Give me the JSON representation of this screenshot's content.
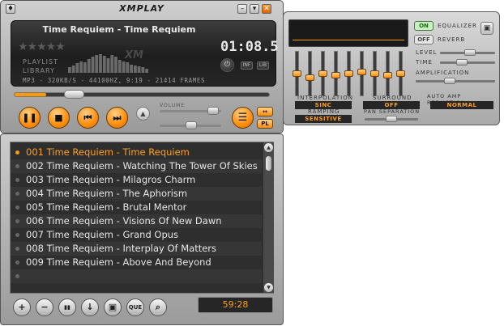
{
  "app_title": "XMPLAY",
  "window_buttons": {
    "options": "♦",
    "minimize": "–",
    "shade": "▾",
    "close": "✕"
  },
  "display": {
    "track_title": "Time Requiem - Time Requiem",
    "rating_stars": "★★★★★",
    "time": "01:08.5",
    "links": {
      "playlist": "PLAYLIST",
      "library": "LIBRARY"
    },
    "logo": "XM",
    "stream_info": "MP3 - 320KB/S - 44100HZ, 9:19 - 21414 FRAMES",
    "mini_buttons": [
      "INF",
      "LIB"
    ],
    "visualizer_levels": [
      0.25,
      0.35,
      0.45,
      0.55,
      0.5,
      0.65,
      0.75,
      0.85,
      0.9,
      0.8,
      0.7,
      0.85,
      0.75,
      0.6,
      0.55,
      0.5,
      0.4,
      0.35,
      0.3,
      0.25,
      0.2
    ]
  },
  "seek": {
    "progress": 0.125
  },
  "transport": {
    "pause": "❚❚",
    "stop": "■",
    "previous": "⏮",
    "next": "⏭",
    "eject": "▲"
  },
  "volume": {
    "label": "VOLUME",
    "level": 0.84,
    "balance": 0.5
  },
  "side_buttons": {
    "playlist_toggle": "☰",
    "top": "↔",
    "pl": "PL"
  },
  "dsp": {
    "eq_on": "ON",
    "eq_label": "EQUALIZER",
    "reverb_off": "OFF",
    "reverb_label": "REVERB",
    "level_label": "LEVEL",
    "time_label": "TIME",
    "amplification_label": "AMPLIFICATION",
    "interpolation_label": "INTERPOLATION",
    "interpolation_value": "SINC",
    "ramping_label": "RAMPING",
    "ramping_value": "SENSITIVE",
    "surround_label": "SURROUND",
    "surround_value": "OFF",
    "pan_label": "PAN SEPARATION",
    "auto_amp_label": "AUTO AMP REDUCTION",
    "auto_amp_value": "NORMAL",
    "save_icon": "▣",
    "eq_bands": [
      0.5,
      0.4,
      0.5,
      0.45,
      0.5,
      0.55,
      0.5,
      0.45,
      0.5
    ]
  },
  "playlist": {
    "items": [
      {
        "text": "001 Time Requiem - Time Requiem",
        "current": true
      },
      {
        "text": "002 Time Requiem - Watching The Tower Of Skies",
        "current": false
      },
      {
        "text": "003 Time Requiem - Milagros Charm",
        "current": false
      },
      {
        "text": "004 Time Requiem - The Aphorism",
        "current": false
      },
      {
        "text": "005 Time Requiem - Brutal Mentor",
        "current": false
      },
      {
        "text": "006 Time Requiem - Visions Of New Dawn",
        "current": false
      },
      {
        "text": "007 Time Requiem - Grand Opus",
        "current": false
      },
      {
        "text": "008 Time Requiem - Interplay Of Matters",
        "current": false
      },
      {
        "text": "009 Time Requiem - Above And Beyond",
        "current": false
      },
      {
        "text": "",
        "current": false
      }
    ],
    "buttons": {
      "add": "+",
      "remove": "−",
      "sort": "▮▮",
      "move_down": "↓",
      "save": "▣",
      "queue": "QUE",
      "search": "⌕"
    },
    "total_time": "59:28"
  },
  "colors": {
    "accent": "#ff9900",
    "display_bg": "#1d1d1d",
    "current_track": "#ffa020"
  }
}
